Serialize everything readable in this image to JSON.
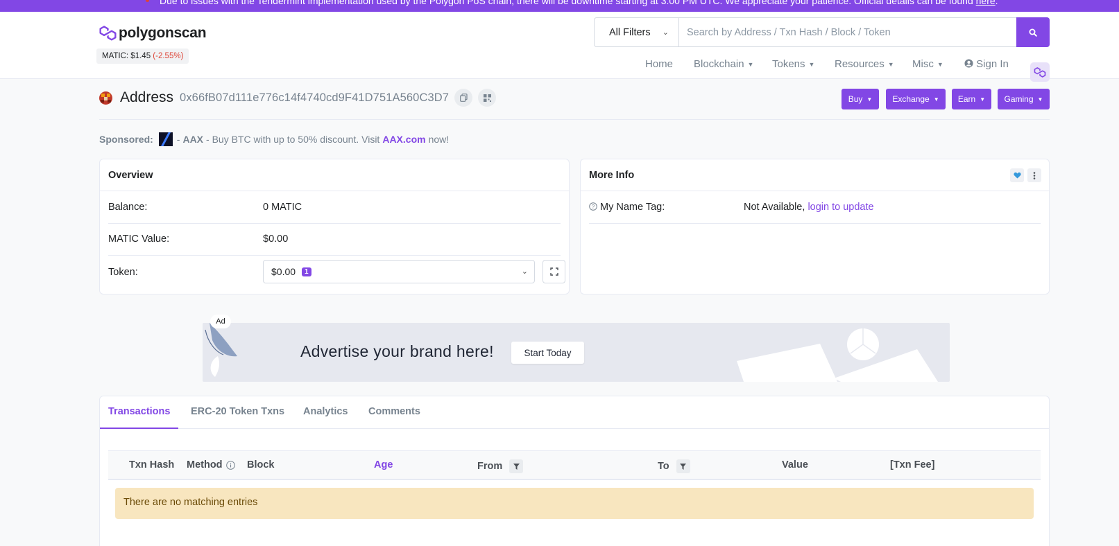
{
  "notice": {
    "text": "Due to issues with the Tendermint implementation used by the Polygon PoS chain, there will be downtime starting at 3:00 PM UTC. We appreciate your patience. Official details can be found",
    "link": "here",
    "end": "."
  },
  "header": {
    "logo_text": "polygonscan",
    "price_label": "MATIC: $1.45",
    "price_change": "(-2.55%)",
    "filter_label": "All Filters",
    "search_placeholder": "Search by Address / Txn Hash / Block / Token",
    "nav": [
      {
        "label": "Home",
        "dropdown": false
      },
      {
        "label": "Blockchain",
        "dropdown": true
      },
      {
        "label": "Tokens",
        "dropdown": true
      },
      {
        "label": "Resources",
        "dropdown": true
      },
      {
        "label": "Misc",
        "dropdown": true
      }
    ],
    "sign_in": "Sign In"
  },
  "address": {
    "title": "Address",
    "hash": "0x66fB07d111e776c14f4740cd9F41D751A560C3D7",
    "actions": [
      "Buy",
      "Exchange",
      "Earn",
      "Gaming"
    ]
  },
  "sponsored": {
    "label": "Sponsored:",
    "dash1": "-",
    "name": "AAX",
    "text": "- Buy BTC with up to 50% discount. Visit",
    "link": "AAX.com",
    "end": "now!"
  },
  "overview": {
    "title": "Overview",
    "balance_label": "Balance:",
    "balance_value": "0 MATIC",
    "value_label": "MATIC Value:",
    "value_value": "$0.00",
    "token_label": "Token:",
    "token_value": "$0.00",
    "token_count": "1"
  },
  "more_info": {
    "title": "More Info",
    "name_tag_label": "My Name Tag:",
    "name_tag_value": "Not Available,",
    "name_tag_link": "login to update"
  },
  "ad": {
    "label": "Ad",
    "headline": "Advertise your brand here!",
    "cta": "Start Today"
  },
  "tabs": [
    "Transactions",
    "ERC-20 Token Txns",
    "Analytics",
    "Comments"
  ],
  "table": {
    "columns": [
      "Txn Hash",
      "Method",
      "Block",
      "Age",
      "From",
      "To",
      "Value",
      "[Txn Fee]"
    ],
    "empty_message": "There are no matching entries"
  },
  "colors": {
    "brand": "#8247e5",
    "negative": "#de4437",
    "empty_bg": "#f8e6bf"
  }
}
